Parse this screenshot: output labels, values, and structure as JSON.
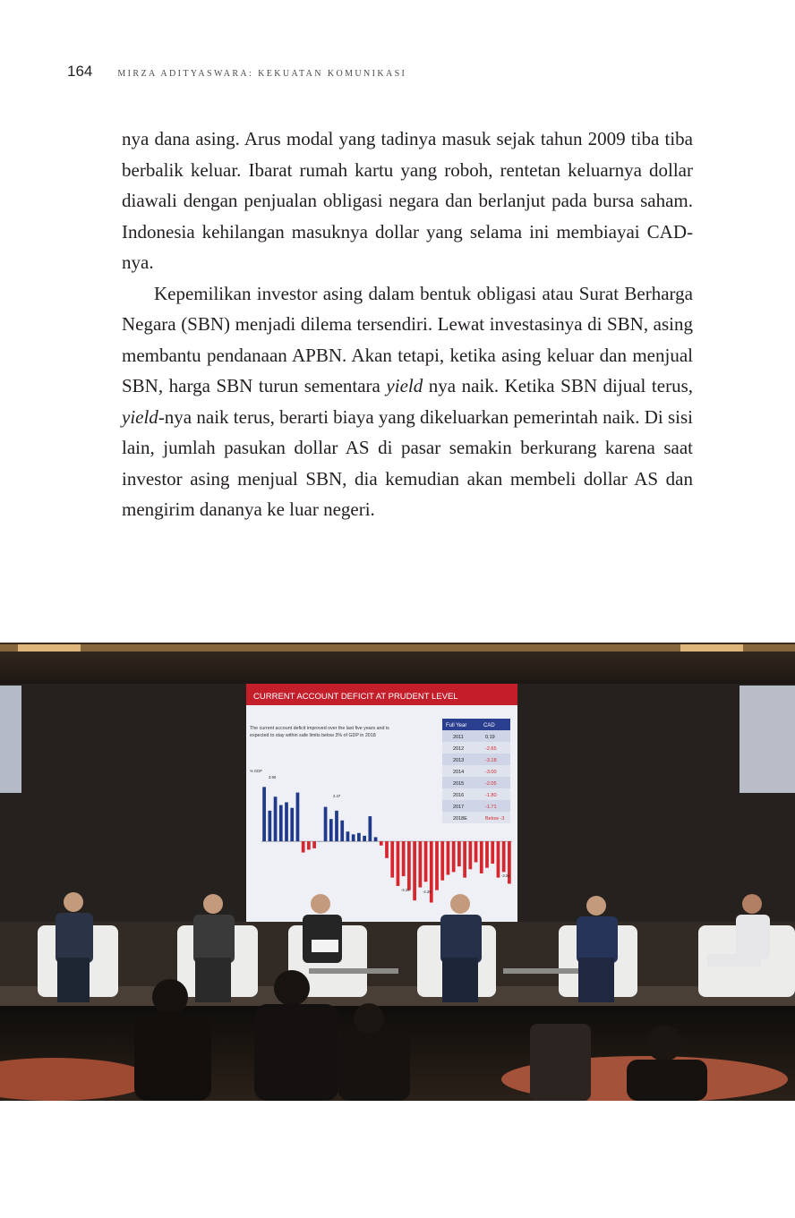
{
  "header": {
    "page_number": "164",
    "running_title": "Mirza Adityaswara: Kekuatan Komunikasi"
  },
  "paragraphs": [
    {
      "segments": [
        {
          "text": "nya dana asing. Arus modal yang tadinya masuk sejak tahun 2009 tiba tiba berbalik keluar. Ibarat rumah kartu yang roboh, rentetan keluarnya dollar diawali dengan penjualan obligasi negara dan berlanjut pada bursa saham. Indonesia kehilangan masuknya dollar yang selama ini membiayai CAD-nya.",
          "italic": false
        }
      ]
    },
    {
      "segments": [
        {
          "text": "Kepemilikan investor asing dalam bentuk obligasi atau Surat Berharga Negara (SBN) menjadi dilema tersendiri. Lewat inves­tasinya di SBN, asing membantu pendanaan APBN. Akan tetapi, ketika asing keluar dan menjual SBN, harga SBN turun sementara ",
          "italic": false
        },
        {
          "text": "yield",
          "italic": true
        },
        {
          "text": " nya naik. Ketika SBN dijual terus, ",
          "italic": false
        },
        {
          "text": "yield",
          "italic": true
        },
        {
          "text": "-nya naik terus, berarti biaya yang dikeluarkan pemerintah naik. Di sisi lain, jumlah pasukan dollar AS di pasar semakin berkurang karena saat investor asing menjual SBN, dia kemudian akan membeli dollar AS dan mengirim dananya ke luar negeri.",
          "italic": false
        }
      ]
    }
  ],
  "photo": {
    "slide": {
      "title": "CURRENT ACCOUNT DEFICIT AT PRUDENT LEVEL",
      "subtitle_lines": [
        "The current account deficit improved over the last five years and is",
        "expected to stay within safe limits below 3% of GDP in 2018"
      ],
      "y_axis_title": "% GDP",
      "table_headers": [
        "Full Year",
        "CAD"
      ],
      "table_rows": [
        [
          "2011",
          "0.19"
        ],
        [
          "2012",
          "-2.65"
        ],
        [
          "2013",
          "-3.18"
        ],
        [
          "2014",
          "-3.00"
        ],
        [
          "2015",
          "-2.05"
        ],
        [
          "2016",
          "-1.80"
        ],
        [
          "2017",
          "-1.71"
        ],
        [
          "2018E",
          "Below -3"
        ]
      ],
      "bar_annotations": [
        "3.90",
        "2.47",
        "-4.24",
        "-4.39",
        "-3.04"
      ],
      "bar_values": [
        3.9,
        2.2,
        3.2,
        2.6,
        2.8,
        2.4,
        3.5,
        -0.8,
        -0.6,
        -0.5,
        0,
        2.47,
        1.6,
        2.2,
        1.5,
        0.7,
        0.5,
        0.6,
        0.4,
        1.8,
        0.3,
        -0.3,
        -1.2,
        -2.6,
        -3.2,
        -2.5,
        -3.5,
        -4.24,
        -3.3,
        -2.9,
        -4.39,
        -3.5,
        -2.8,
        -2.4,
        -2.2,
        -1.8,
        -2.6,
        -2.0,
        -1.5,
        -2.3,
        -1.9,
        -1.6,
        -2.6,
        -2.2,
        -3.04
      ],
      "chart_ylim": [
        -5,
        4.5
      ],
      "colors": {
        "positive": "#1f3a8a",
        "negative": "#d7262e",
        "title_bar": "#c41e2a",
        "table_header": "#2a3f8f"
      }
    },
    "colors": {
      "slide_title_bar": "#c41e2a",
      "stage_bg": "#2a2521",
      "chairs": "#eeeeea"
    }
  }
}
